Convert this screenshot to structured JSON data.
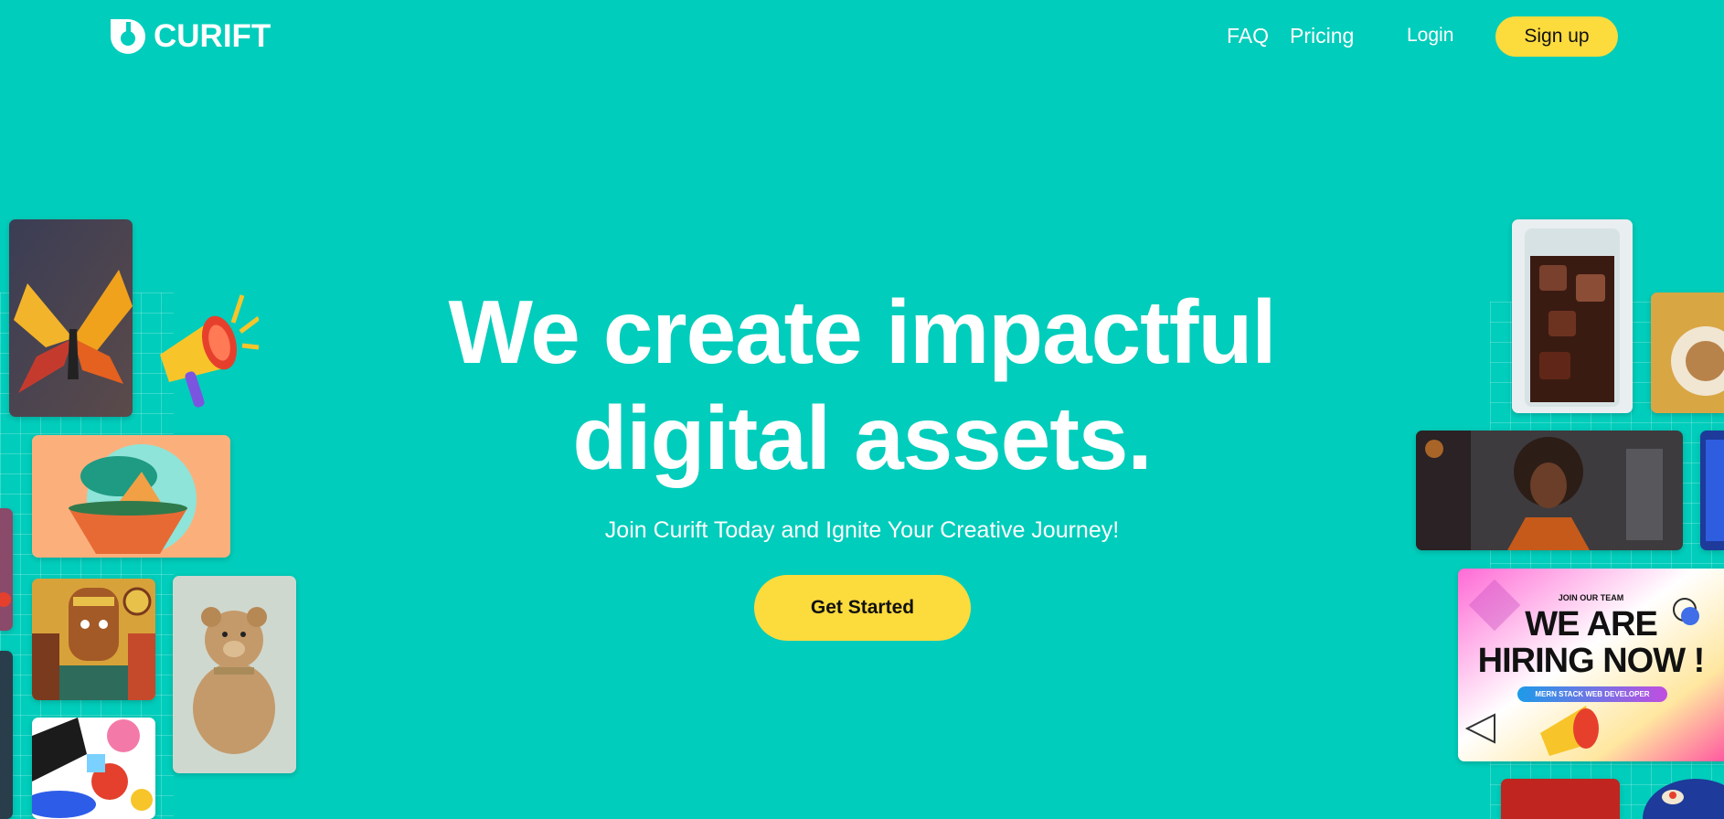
{
  "brand": {
    "name": "CURIFT",
    "logo_icon": "curift-logo-icon"
  },
  "nav": {
    "faq": "FAQ",
    "pricing": "Pricing",
    "login": "Login",
    "signup": "Sign up"
  },
  "hero": {
    "title_line1": "We create impactful",
    "title_line2": "digital assets.",
    "subtitle": "Join Curift Today and Ignite Your Creative Journey!",
    "cta": "Get Started"
  },
  "hiring_card": {
    "kicker": "JOIN OUR TEAM",
    "headline_1": "WE ARE",
    "headline_2": "HIRING NOW !",
    "role": "MERN STACK WEB DEVELOPER"
  },
  "colors": {
    "background": "#00CDBB",
    "accent_yellow": "#FCDB3D",
    "text_white": "#FFFFFF"
  }
}
